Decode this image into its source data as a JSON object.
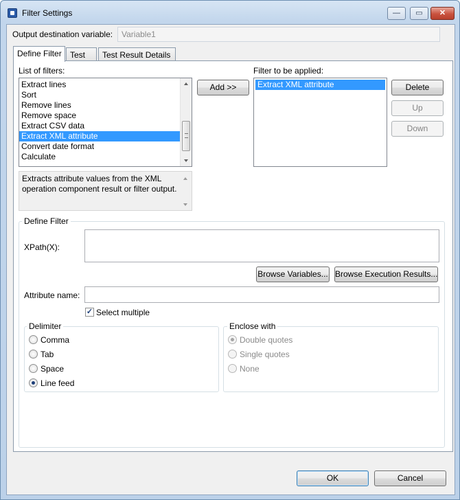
{
  "window": {
    "title": "Filter Settings",
    "minimize_glyph": "—",
    "restore_glyph": "▭",
    "close_glyph": "✕"
  },
  "output": {
    "label": "Output destination variable:",
    "value": "Variable1"
  },
  "tabs": [
    {
      "label": "Define Filter"
    },
    {
      "label": "Test"
    },
    {
      "label": "Test Result Details"
    }
  ],
  "filters": {
    "list_label": "List of filters:",
    "items": [
      "Extract lines",
      "Sort",
      "Remove lines",
      "Remove space",
      "Extract CSV data",
      "Extract XML attribute",
      "Convert date format",
      "Calculate"
    ],
    "selected": "Extract XML attribute",
    "description": "Extracts attribute values from the XML operation component result or filter output.",
    "add_label": "Add >>",
    "applied_label": "Filter to be applied:",
    "applied_items": [
      "Extract XML attribute"
    ],
    "delete_label": "Delete",
    "up_label": "Up",
    "down_label": "Down"
  },
  "define": {
    "group_label": "Define Filter",
    "xpath_label": "XPath(X):",
    "browse_vars_label": "Browse Variables...",
    "browse_results_label": "Browse Execution Results...",
    "attr_label": "Attribute name:",
    "select_multiple_label": "Select multiple",
    "select_multiple_checked": true
  },
  "delimiter": {
    "label": "Delimiter",
    "options": [
      "Comma",
      "Tab",
      "Space",
      "Line feed"
    ],
    "selected": "Line feed"
  },
  "enclose": {
    "label": "Enclose with",
    "options": [
      "Double quotes",
      "Single quotes",
      "None"
    ],
    "selected": "Double quotes",
    "enabled": false
  },
  "footer": {
    "ok_label": "OK",
    "cancel_label": "Cancel"
  },
  "colors": {
    "selection": "#3399ff",
    "title_bar": "#c2d6ec",
    "close_button": "#c9523e"
  }
}
